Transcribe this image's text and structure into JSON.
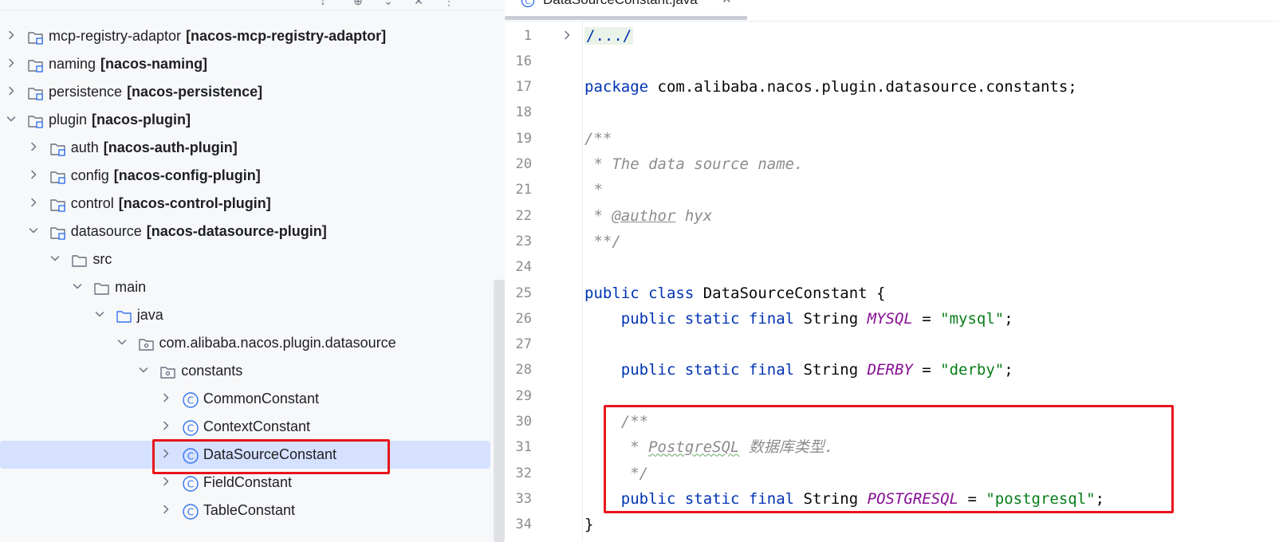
{
  "project_tree": {
    "rows": [
      {
        "label": "mcp-registry-adaptor",
        "module": "[nacos-mcp-registry-adaptor]",
        "chevron": "right",
        "icon": "module-folder-icon",
        "depth": 0
      },
      {
        "label": "naming",
        "module": "[nacos-naming]",
        "chevron": "right",
        "icon": "module-folder-icon",
        "depth": 0
      },
      {
        "label": "persistence",
        "module": "[nacos-persistence]",
        "chevron": "right",
        "icon": "module-folder-icon",
        "depth": 0
      },
      {
        "label": "plugin",
        "module": "[nacos-plugin]",
        "chevron": "down",
        "icon": "module-folder-icon",
        "depth": 0
      },
      {
        "label": "auth",
        "module": "[nacos-auth-plugin]",
        "chevron": "right",
        "icon": "module-folder-icon",
        "depth": 1
      },
      {
        "label": "config",
        "module": "[nacos-config-plugin]",
        "chevron": "right",
        "icon": "module-folder-icon",
        "depth": 1
      },
      {
        "label": "control",
        "module": "[nacos-control-plugin]",
        "chevron": "right",
        "icon": "module-folder-icon",
        "depth": 1
      },
      {
        "label": "datasource",
        "module": "[nacos-datasource-plugin]",
        "chevron": "down",
        "icon": "module-folder-icon",
        "depth": 1
      },
      {
        "label": "src",
        "module": "",
        "chevron": "down",
        "icon": "folder-icon",
        "depth": 2
      },
      {
        "label": "main",
        "module": "",
        "chevron": "down",
        "icon": "folder-icon",
        "depth": 3
      },
      {
        "label": "java",
        "module": "",
        "chevron": "down",
        "icon": "source-folder-icon",
        "depth": 4
      },
      {
        "label": "com.alibaba.nacos.plugin.datasource",
        "module": "",
        "chevron": "down",
        "icon": "package-icon",
        "depth": 5
      },
      {
        "label": "constants",
        "module": "",
        "chevron": "down",
        "icon": "package-icon",
        "depth": 6
      },
      {
        "label": "CommonConstant",
        "module": "",
        "chevron": "right",
        "icon": "class-icon",
        "depth": 7
      },
      {
        "label": "ContextConstant",
        "module": "",
        "chevron": "right",
        "icon": "class-icon",
        "depth": 7
      },
      {
        "label": "DataSourceConstant",
        "module": "",
        "chevron": "right",
        "icon": "class-icon",
        "depth": 7,
        "selected": true
      },
      {
        "label": "FieldConstant",
        "module": "",
        "chevron": "right",
        "icon": "class-icon",
        "depth": 7
      },
      {
        "label": "TableConstant",
        "module": "",
        "chevron": "right",
        "icon": "class-icon",
        "depth": 7
      }
    ]
  },
  "editor": {
    "tab_title": "DataSourceConstant.java",
    "tab_icon": "class-icon",
    "lines": [
      {
        "n": "1",
        "fold": true,
        "segs": [
          {
            "t": "/.../",
            "c": "folded"
          }
        ]
      },
      {
        "n": "16",
        "segs": []
      },
      {
        "n": "17",
        "segs": [
          {
            "t": "package",
            "c": "kw"
          },
          {
            "t": " com.alibaba.nacos.plugin.datasource.constants;",
            "c": ""
          }
        ]
      },
      {
        "n": "18",
        "segs": []
      },
      {
        "n": "19",
        "segs": [
          {
            "t": "/**",
            "c": "cm"
          }
        ]
      },
      {
        "n": "20",
        "segs": [
          {
            "t": " * The data source name.",
            "c": "cm"
          }
        ]
      },
      {
        "n": "21",
        "segs": [
          {
            "t": " *",
            "c": "cm"
          }
        ]
      },
      {
        "n": "22",
        "segs": [
          {
            "t": " * ",
            "c": "cm"
          },
          {
            "t": "@author",
            "c": "tg"
          },
          {
            "t": " hyx",
            "c": "cm"
          }
        ]
      },
      {
        "n": "23",
        "segs": [
          {
            "t": " **/",
            "c": "cm"
          }
        ]
      },
      {
        "n": "24",
        "segs": []
      },
      {
        "n": "25",
        "segs": [
          {
            "t": "public class",
            "c": "kw"
          },
          {
            "t": " DataSourceConstant {",
            "c": ""
          }
        ]
      },
      {
        "n": "26",
        "segs": [
          {
            "t": "    public static final",
            "c": "kw"
          },
          {
            "t": " String ",
            "c": ""
          },
          {
            "t": "MYSQL",
            "c": "cn"
          },
          {
            "t": " = ",
            "c": ""
          },
          {
            "t": "\"mysql\"",
            "c": "st"
          },
          {
            "t": ";",
            "c": ""
          }
        ]
      },
      {
        "n": "27",
        "segs": []
      },
      {
        "n": "28",
        "segs": [
          {
            "t": "    public static final",
            "c": "kw"
          },
          {
            "t": " String ",
            "c": ""
          },
          {
            "t": "DERBY",
            "c": "cn"
          },
          {
            "t": " = ",
            "c": ""
          },
          {
            "t": "\"derby\"",
            "c": "st"
          },
          {
            "t": ";",
            "c": ""
          }
        ]
      },
      {
        "n": "29",
        "segs": []
      },
      {
        "n": "30",
        "segs": [
          {
            "t": "    /**",
            "c": "cm"
          }
        ]
      },
      {
        "n": "31",
        "segs": [
          {
            "t": "     * ",
            "c": "cm"
          },
          {
            "t": "PostgreSQL",
            "c": "cm squig"
          },
          {
            "t": " 数据库类型.",
            "c": "cm"
          }
        ]
      },
      {
        "n": "32",
        "segs": [
          {
            "t": "     */",
            "c": "cm"
          }
        ]
      },
      {
        "n": "33",
        "segs": [
          {
            "t": "    public static final",
            "c": "kw"
          },
          {
            "t": " String ",
            "c": ""
          },
          {
            "t": "POSTGRESQL",
            "c": "cn"
          },
          {
            "t": " = ",
            "c": ""
          },
          {
            "t": "\"postgresql\"",
            "c": "st"
          },
          {
            "t": ";",
            "c": ""
          }
        ]
      },
      {
        "n": "34",
        "segs": [
          {
            "t": "}",
            "c": ""
          }
        ]
      }
    ]
  },
  "colors": {
    "highlight_box": "#e8141c",
    "selection": "#d5e1ff",
    "keyword": "#0033b3",
    "comment": "#8c8c8c",
    "constant": "#871094",
    "string": "#067d17"
  }
}
